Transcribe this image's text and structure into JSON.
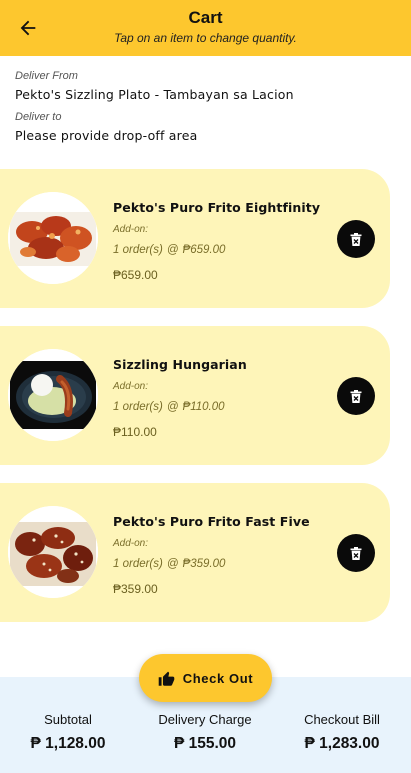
{
  "header": {
    "title": "Cart",
    "subtitle": "Tap on an item to change quantity.",
    "back_icon": "arrow-left-icon"
  },
  "delivery": {
    "from_label": "Deliver From",
    "from_value": "Pekto's Sizzling Plato - Tambayan sa Lacion",
    "to_label": "Deliver to",
    "to_value": "Please provide drop-off area"
  },
  "items": [
    {
      "name": "Pekto's Puro Frito Eightfinity",
      "addon_label": "Add-on:",
      "quantity": "1 order(s)",
      "at": "@",
      "unit_price": "₱659.00",
      "total": "₱659.00",
      "delete_icon": "trash-icon"
    },
    {
      "name": "Sizzling Hungarian",
      "addon_label": "Add-on:",
      "quantity": "1 order(s)",
      "at": "@",
      "unit_price": "₱110.00",
      "total": "₱110.00",
      "delete_icon": "trash-icon"
    },
    {
      "name": "Pekto's Puro Frito Fast Five",
      "addon_label": "Add-on:",
      "quantity": "1 order(s)",
      "at": "@",
      "unit_price": "₱359.00",
      "total": "₱359.00",
      "delete_icon": "trash-icon"
    }
  ],
  "checkout": {
    "label": "Check Out",
    "icon": "thumbs-up-icon"
  },
  "summary": {
    "subtotal_label": "Subtotal",
    "subtotal_value": "₱ 1,128.00",
    "delivery_label": "Delivery Charge",
    "delivery_value": "₱ 155.00",
    "bill_label": "Checkout Bill",
    "bill_value": "₱ 1,283.00"
  },
  "colors": {
    "accent": "#fdc72e",
    "card_background": "#fef5b9",
    "footer_background": "#e8f3fc",
    "delete_button": "#0a0a0a"
  }
}
